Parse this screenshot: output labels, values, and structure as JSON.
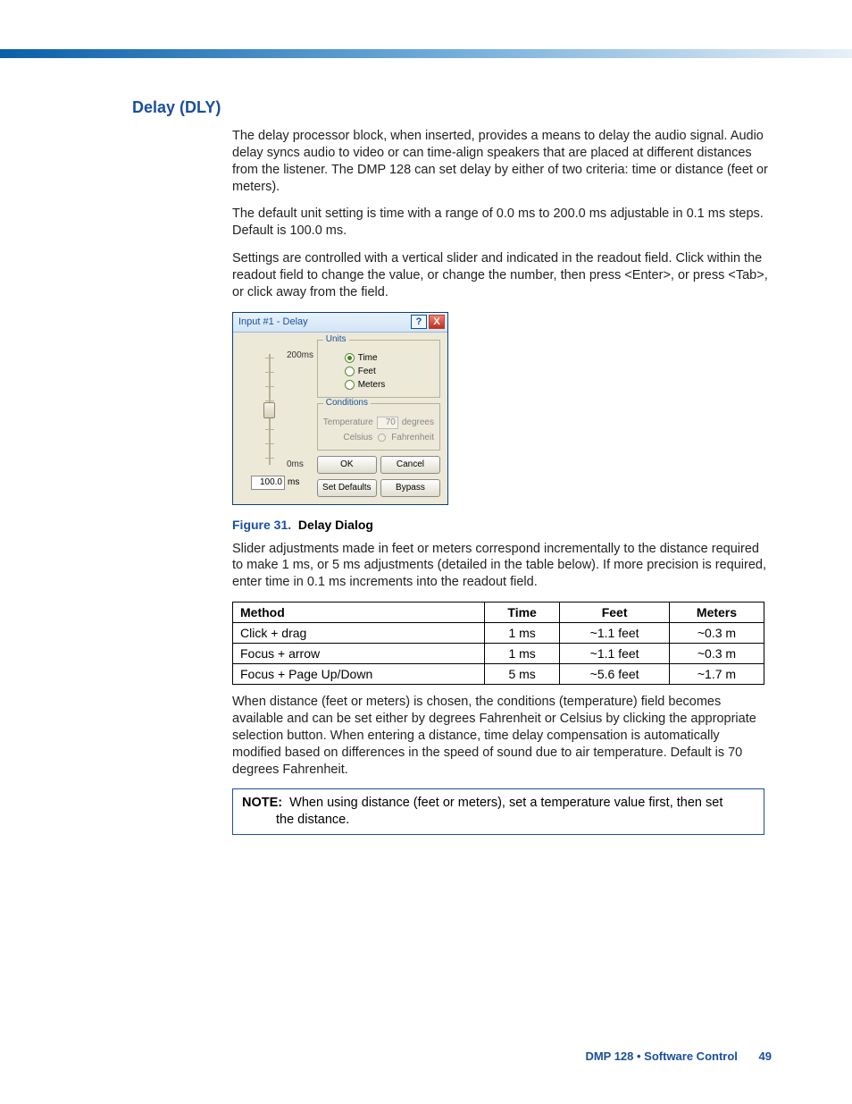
{
  "section_heading": "Delay (DLY)",
  "para1": "The delay processor block, when inserted, provides a means to delay the audio signal. Audio delay syncs audio to video or can time-align speakers that are placed at different distances from the listener. The DMP 128 can set delay by either of two criteria: time or distance (feet or meters).",
  "para2": "The default unit setting is time with a range of 0.0 ms to 200.0 ms adjustable in 0.1 ms steps. Default is 100.0 ms.",
  "para3": "Settings are controlled with a vertical slider and indicated in the readout field. Click within the readout field to change the value, or change the number, then press <Enter>, or press <Tab>, or click away from the field.",
  "dialog": {
    "title": "Input #1 - Delay",
    "help": "?",
    "close": "X",
    "slider": {
      "max_label": "200ms",
      "min_label": "0ms",
      "readout_value": "100.0",
      "readout_unit": "ms"
    },
    "units": {
      "legend": "Units",
      "opt_time": "Time",
      "opt_feet": "Feet",
      "opt_meters": "Meters"
    },
    "conditions": {
      "legend": "Conditions",
      "temp_label": "Temperature",
      "temp_value": "70",
      "temp_unit": "degrees",
      "celsius": "Celsius",
      "fahrenheit": "Fahrenheit"
    },
    "buttons": {
      "ok": "OK",
      "cancel": "Cancel",
      "defaults": "Set Defaults",
      "bypass": "Bypass"
    }
  },
  "figure": {
    "num": "Figure 31.",
    "title": "Delay Dialog"
  },
  "para4": "Slider adjustments made in feet or meters correspond incrementally to the distance required to make 1 ms, or 5 ms adjustments (detailed in the table below). If more precision is required, enter time in 0.1 ms increments into the readout field.",
  "table": {
    "headers": [
      "Method",
      "Time",
      "Feet",
      "Meters"
    ],
    "rows": [
      [
        "Click + drag",
        "1 ms",
        "~1.1 feet",
        "~0.3 m"
      ],
      [
        "Focus + arrow",
        "1 ms",
        "~1.1 feet",
        "~0.3 m"
      ],
      [
        "Focus + Page Up/Down",
        "5 ms",
        "~5.6 feet",
        "~1.7 m"
      ]
    ]
  },
  "para5": "When distance (feet or meters) is chosen, the conditions (temperature) field becomes available and can be set either by degrees Fahrenheit or Celsius by clicking the appropriate selection button. When entering a distance, time delay compensation is automatically modified based on differences in the speed of sound due to air temperature. Default is 70 degrees Fahrenheit.",
  "note": {
    "label": "NOTE:",
    "line1": "When using distance (feet or meters), set a temperature value first, then set",
    "line2": "the distance."
  },
  "footer": {
    "doc": "DMP 128 • Software Control",
    "page": "49"
  }
}
